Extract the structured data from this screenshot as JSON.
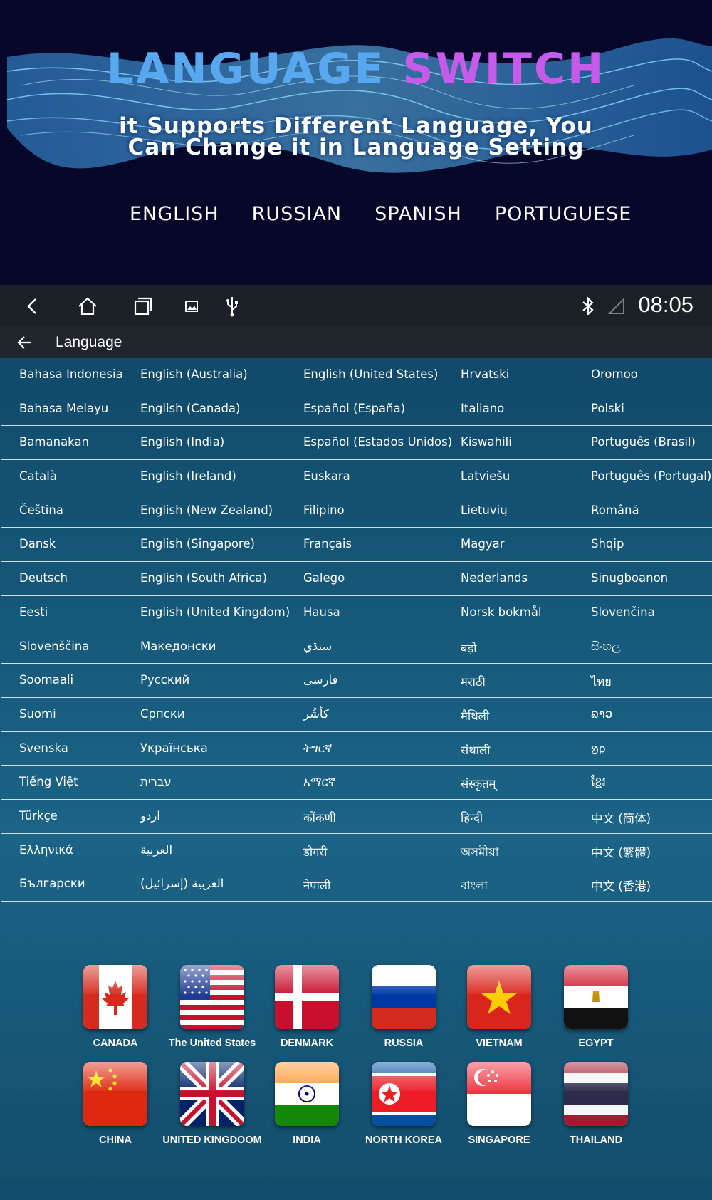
{
  "banner": {
    "title_part1": "LANGUAGE",
    "title_part2": "SWITCH",
    "subtitle": "it Supports Different Language, You Can Change it in Language Setting",
    "languages": [
      "ENGLISH",
      "RUSSIAN",
      "SPANISH",
      "PORTUGUESE"
    ]
  },
  "statusbar": {
    "time": "08:05",
    "icons": [
      "back-icon",
      "home-icon",
      "recent-apps-icon",
      "screenshot-icon",
      "usb-icon",
      "bluetooth-icon",
      "signal-icon"
    ]
  },
  "settings": {
    "title": "Language",
    "rows": [
      [
        "Bahasa Indonesia",
        "English (Australia)",
        "English (United States)",
        "Hrvatski",
        "Oromoo"
      ],
      [
        "Bahasa Melayu",
        "English (Canada)",
        "Español (España)",
        "Italiano",
        "Polski"
      ],
      [
        "Bamanakan",
        "English (India)",
        "Español (Estados Unidos)",
        "Kiswahili",
        "Português (Brasil)"
      ],
      [
        "Català",
        "English (Ireland)",
        "Euskara",
        "Latviešu",
        "Português (Portugal)"
      ],
      [
        "Čeština",
        "English (New Zealand)",
        "Filipino",
        "Lietuvių",
        "Română"
      ],
      [
        "Dansk",
        "English (Singapore)",
        "Français",
        "Magyar",
        "Shqip"
      ],
      [
        "Deutsch",
        "English (South Africa)",
        "Galego",
        "Nederlands",
        "Sinugboanon"
      ],
      [
        "Eesti",
        "English (United Kingdom)",
        "Hausa",
        "Norsk bokmål",
        "Slovenčina"
      ],
      [
        "Slovenščina",
        "Македонски",
        "سنڌي",
        "बड़ो",
        "සිංහල"
      ],
      [
        "Soomaali",
        "Русский",
        "فارسی",
        "मराठी",
        "ไทย"
      ],
      [
        "Suomi",
        "Српски",
        "کأشُر",
        "मैथिली",
        "ລາວ"
      ],
      [
        "Svenska",
        "Українська",
        "ትግርኛ",
        "संथाली",
        "ᱚᱞ"
      ],
      [
        "Tiếng Việt",
        "עברית",
        "አማርኛ",
        "संस्कृतम्",
        "ខ្មែរ"
      ],
      [
        "Türkçe",
        "اردو",
        "कोंकणी",
        "हिन्दी",
        "中文 (简体)"
      ],
      [
        "Ελληνικά",
        "العربية",
        "डोगरी",
        "অসমীয়া",
        "中文 (繁體)"
      ],
      [
        "Български",
        "العربية (إسرائيل)",
        "नेपाली",
        "বাংলা",
        "中文 (香港)"
      ]
    ]
  },
  "flags": [
    {
      "label": "CANADA",
      "icon": "canada-flag-icon"
    },
    {
      "label": "The United States",
      "icon": "usa-flag-icon"
    },
    {
      "label": "DENMARK",
      "icon": "denmark-flag-icon"
    },
    {
      "label": "RUSSIA",
      "icon": "russia-flag-icon"
    },
    {
      "label": "VIETNAM",
      "icon": "vietnam-flag-icon"
    },
    {
      "label": "EGYPT",
      "icon": "egypt-flag-icon"
    },
    {
      "label": "CHINA",
      "icon": "china-flag-icon"
    },
    {
      "label": "UNITED KINGDOOM",
      "icon": "uk-flag-icon"
    },
    {
      "label": "INDIA",
      "icon": "india-flag-icon"
    },
    {
      "label": "NORTH KOREA",
      "icon": "north-korea-flag-icon"
    },
    {
      "label": "SINGAPORE",
      "icon": "singapore-flag-icon"
    },
    {
      "label": "THAILAND",
      "icon": "thailand-flag-icon"
    }
  ]
}
